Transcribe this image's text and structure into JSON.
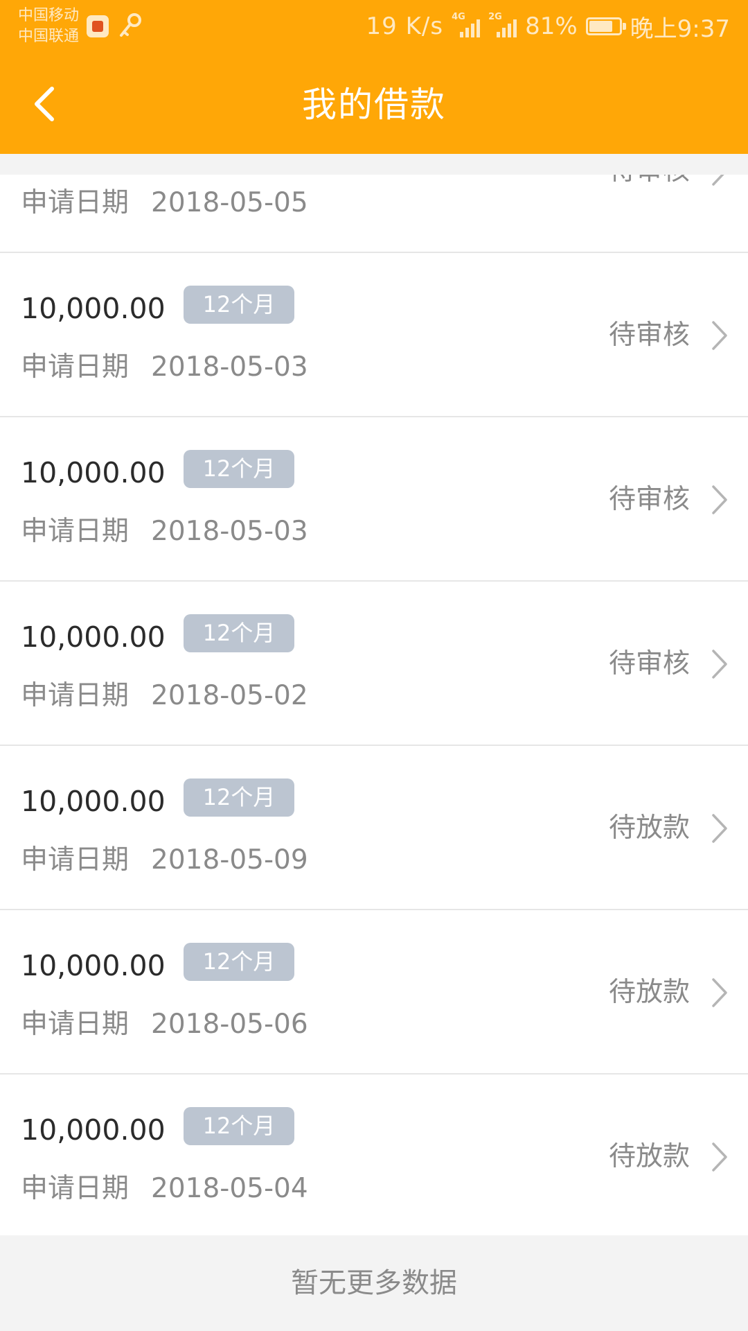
{
  "status_bar": {
    "carrier_1": "中国移动",
    "carrier_2": "中国联通",
    "net_speed": "19 K/s",
    "signal_1_tag": "4G",
    "signal_2_tag": "2G",
    "battery_percent_text": "81%",
    "battery_level": 0.81,
    "time": "晚上9:37"
  },
  "header": {
    "title": "我的借款"
  },
  "loans": [
    {
      "amount": "",
      "term": "",
      "date_label": "申请日期",
      "date": "2018-05-05",
      "status": "待审核"
    },
    {
      "amount": "10,000.00",
      "term": "12个月",
      "date_label": "申请日期",
      "date": "2018-05-03",
      "status": "待审核"
    },
    {
      "amount": "10,000.00",
      "term": "12个月",
      "date_label": "申请日期",
      "date": "2018-05-03",
      "status": "待审核"
    },
    {
      "amount": "10,000.00",
      "term": "12个月",
      "date_label": "申请日期",
      "date": "2018-05-02",
      "status": "待审核"
    },
    {
      "amount": "10,000.00",
      "term": "12个月",
      "date_label": "申请日期",
      "date": "2018-05-09",
      "status": "待放款"
    },
    {
      "amount": "10,000.00",
      "term": "12个月",
      "date_label": "申请日期",
      "date": "2018-05-06",
      "status": "待放款"
    },
    {
      "amount": "10,000.00",
      "term": "12个月",
      "date_label": "申请日期",
      "date": "2018-05-04",
      "status": "待放款"
    }
  ],
  "footer": {
    "no_more_text": "暂无更多数据"
  },
  "colors": {
    "header_bg": "#ffa707",
    "badge_bg": "#bcc5d1"
  }
}
